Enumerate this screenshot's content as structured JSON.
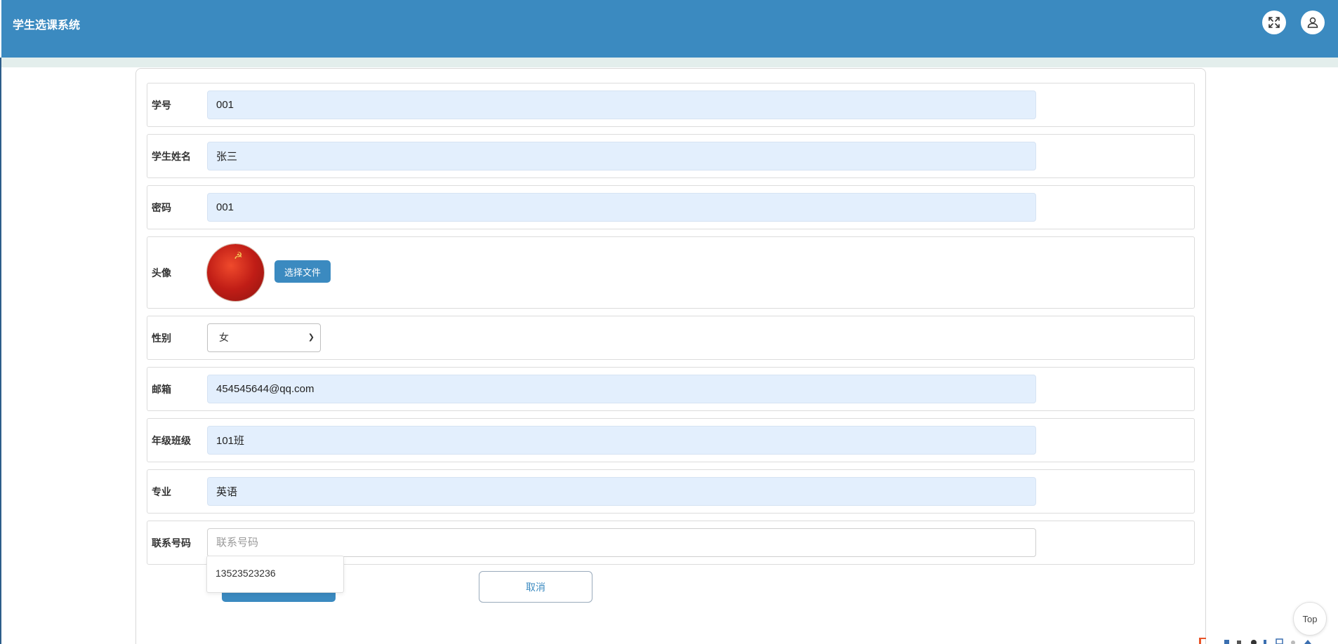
{
  "header": {
    "app_title": "学生选课系统",
    "fullscreen_icon": "fullscreen-icon",
    "user_icon": "user-icon"
  },
  "form": {
    "student_id": {
      "label": "学号",
      "value": "001"
    },
    "student_name": {
      "label": "学生姓名",
      "value": "张三"
    },
    "password": {
      "label": "密码",
      "value": "001"
    },
    "avatar": {
      "label": "头像",
      "button_label": "选择文件"
    },
    "gender": {
      "label": "性别",
      "selected": "女"
    },
    "email": {
      "label": "邮箱",
      "value": "454545644@qq.com"
    },
    "grade_class": {
      "label": "年级班级",
      "value": "101班"
    },
    "major": {
      "label": "专业",
      "value": "英语"
    },
    "phone": {
      "label": "联系号码",
      "value": "",
      "placeholder": "联系号码",
      "suggestion": "13523523236"
    }
  },
  "actions": {
    "cancel_label": "取消"
  },
  "scroll_top": {
    "label": "Top"
  },
  "colors": {
    "primary": "#3b8ac0",
    "input_fill": "#e3effd",
    "subbar": "#e3eeec"
  }
}
